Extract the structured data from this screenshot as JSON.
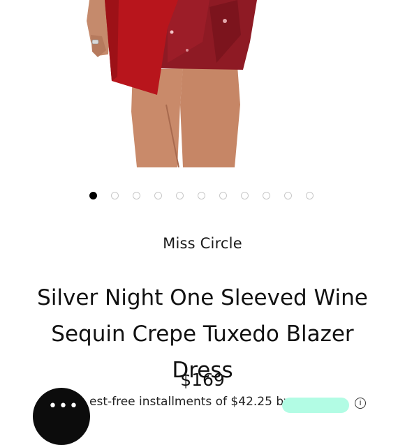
{
  "product": {
    "brand": "Miss Circle",
    "title": "Silver Night One Sleeved Wine Sequin Crepe Tuxedo Blazer Dress",
    "price": "$169",
    "installments_text": "est-free installments of $42.25 by",
    "image_alt": "Model wearing wine sequin blazer dress"
  },
  "carousel": {
    "total": 11,
    "active_index": 0
  },
  "icons": {
    "info": "info-icon",
    "chat": "chat-bubble-icon",
    "afterpay": "afterpay-logo"
  },
  "colors": {
    "accent": "#b8151c",
    "sequin": "#8e1a24",
    "dot_active": "#000000",
    "dot_inactive": "#c8c8c8",
    "afterpay": "#b2fce4"
  }
}
